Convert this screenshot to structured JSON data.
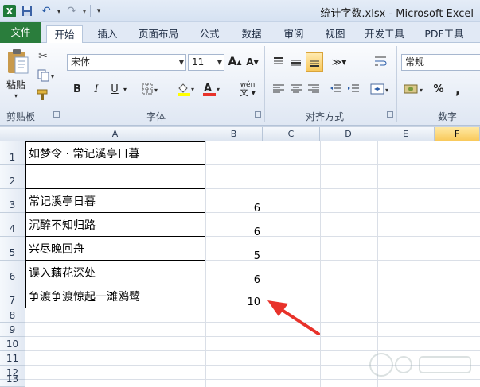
{
  "window": {
    "title": "统计字数.xlsx - Microsoft Excel",
    "app_logo": "X"
  },
  "qat": {
    "icons": [
      "excel-logo-icon",
      "save-icon",
      "undo-icon",
      "redo-icon",
      "customize-qat-icon"
    ]
  },
  "tabs": [
    {
      "label": "文件",
      "active": false
    },
    {
      "label": "开始",
      "active": true
    },
    {
      "label": "插入",
      "active": false
    },
    {
      "label": "页面布局",
      "active": false
    },
    {
      "label": "公式",
      "active": false
    },
    {
      "label": "数据",
      "active": false
    },
    {
      "label": "审阅",
      "active": false
    },
    {
      "label": "视图",
      "active": false
    },
    {
      "label": "开发工具",
      "active": false
    },
    {
      "label": "PDF工具",
      "active": false
    }
  ],
  "ribbon": {
    "clipboard": {
      "label": "剪贴板",
      "paste_label": "粘贴"
    },
    "font": {
      "label": "字体",
      "font_name": "宋体",
      "font_size": "11",
      "bold": "B",
      "italic": "I",
      "underline": "U",
      "grow": "A",
      "shrink": "A",
      "phonetic": "wén"
    },
    "alignment": {
      "label": "对齐方式"
    },
    "number": {
      "label": "数字",
      "format": "常规",
      "percent": "%",
      "comma": ","
    }
  },
  "grid": {
    "columns": [
      "A",
      "B",
      "C",
      "D",
      "E",
      "F"
    ],
    "selected_column": "F",
    "rows": [
      "1",
      "2",
      "3",
      "4",
      "5",
      "6",
      "7",
      "8",
      "9",
      "10",
      "11",
      "12",
      "13"
    ],
    "cells": [
      {
        "row": "1",
        "a": "如梦令 · 常记溪亭日暮",
        "b": ""
      },
      {
        "row": "2",
        "a": "",
        "b": ""
      },
      {
        "row": "3",
        "a": "常记溪亭日暮",
        "b": "6"
      },
      {
        "row": "4",
        "a": "沉醉不知归路",
        "b": "6"
      },
      {
        "row": "5",
        "a": "兴尽晚回舟",
        "b": "5"
      },
      {
        "row": "6",
        "a": "误入藕花深处",
        "b": "6"
      },
      {
        "row": "7",
        "a": "争渡争渡惊起一滩鸥鹭",
        "b": "10"
      }
    ]
  },
  "annotation": {
    "arrow_color": "#e8322a"
  },
  "colors": {
    "file_tab": "#2a7d3c",
    "selected_column": "#f9c95b"
  }
}
